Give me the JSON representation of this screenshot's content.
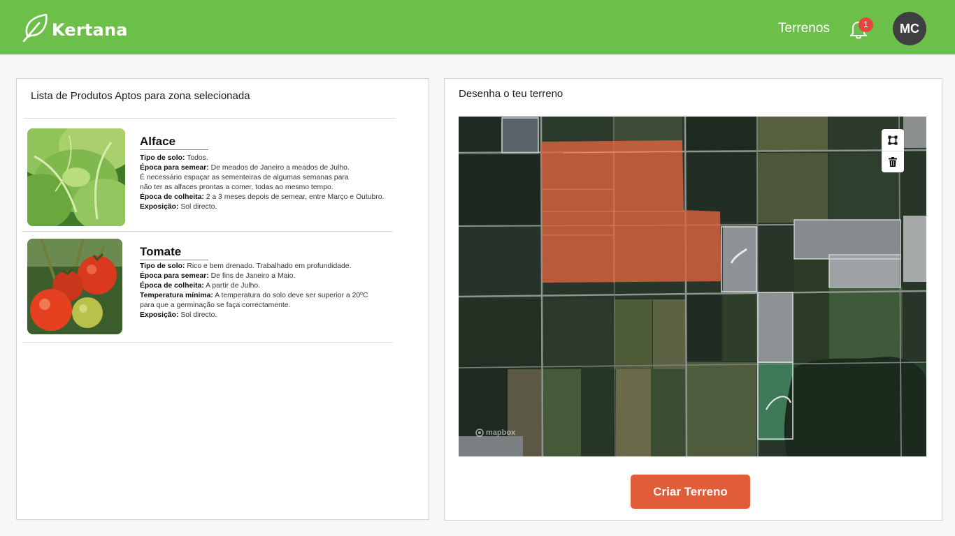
{
  "header": {
    "brand": "Kertana",
    "nav_link": "Terrenos",
    "notifications_count": "1",
    "user_initials": "MC",
    "bell_icon": "bell-icon",
    "logo_icon": "leaf-icon"
  },
  "products_panel": {
    "title": "Lista de Produtos Aptos para zona selecionada",
    "items": [
      {
        "name": "Alface",
        "image_icon": "lettuce-image",
        "lines": [
          {
            "label": "Tipo de solo:",
            "text": " Todos."
          },
          {
            "label": "Época para semear:",
            "text": " De meados de Janeiro a meados de Julho."
          },
          {
            "label": "",
            "text": "É necessário espaçar as sementeiras de algumas semanas para"
          },
          {
            "label": "",
            "text": "não ter as alfaces prontas a comer, todas ao mesmo tempo."
          },
          {
            "label": "Época de colheita:",
            "text": " 2 a 3 meses depois de semear, entre Março e Outubro."
          },
          {
            "label": "Exposição:",
            "text": " Sol directo."
          }
        ]
      },
      {
        "name": "Tomate",
        "image_icon": "tomato-image",
        "lines": [
          {
            "label": "Tipo de solo:",
            "text": " Rico e bem drenado. Trabalhado em profundidade."
          },
          {
            "label": "Época para semear:",
            "text": " De fins de Janeiro a Maio."
          },
          {
            "label": "Época de colheita:",
            "text": " A partir de Julho."
          },
          {
            "label": "Temperatura mínima:",
            "text": " A temperatura do solo deve ser superior a 20ºC"
          },
          {
            "label": "",
            "text": "para que a germinação se faça correctamente."
          },
          {
            "label": "Exposição:",
            "text": " Sol directo."
          }
        ]
      }
    ]
  },
  "map_panel": {
    "title": "Desenha o teu terreno",
    "attribution": "mapbox",
    "controls": [
      "polygon-draw-icon",
      "trash-icon"
    ],
    "create_button": "Criar Terreno"
  },
  "colors": {
    "header_green": "#6cc04a",
    "accent_orange": "#e15d3a",
    "badge_red": "#e8463c",
    "avatar_dark": "#3f3f41",
    "selection_fill": "#d9643f"
  }
}
